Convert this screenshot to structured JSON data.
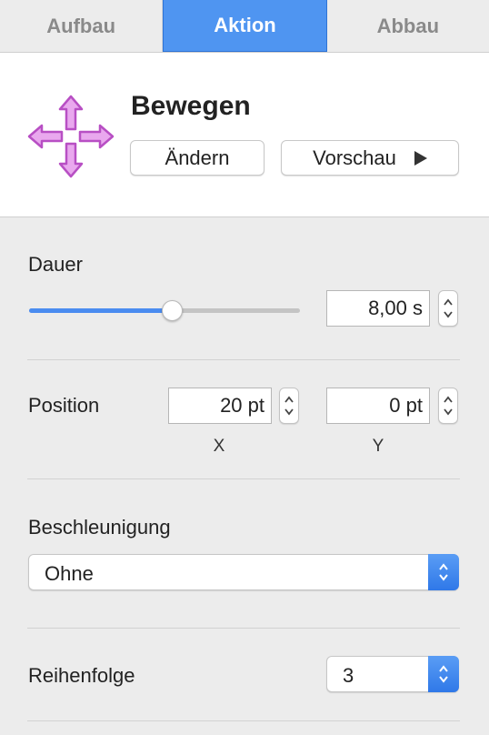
{
  "tabs": [
    {
      "label": "Aufbau",
      "active": false
    },
    {
      "label": "Aktion",
      "active": true
    },
    {
      "label": "Abbau",
      "active": false
    }
  ],
  "effect": {
    "icon": "move-arrows-icon",
    "title": "Bewegen",
    "change_label": "Ändern",
    "preview_label": "Vorschau"
  },
  "duration": {
    "label": "Dauer",
    "value": "8,00 s",
    "slider_fraction": 0.53
  },
  "position": {
    "label": "Position",
    "x_value": "20 pt",
    "x_label": "X",
    "y_value": "0 pt",
    "y_label": "Y"
  },
  "acceleration": {
    "label": "Beschleunigung",
    "value": "Ohne"
  },
  "order": {
    "label": "Reihenfolge",
    "value": "3"
  },
  "colors": {
    "accent": "#4f95f1",
    "icon": "#d86fdf"
  }
}
